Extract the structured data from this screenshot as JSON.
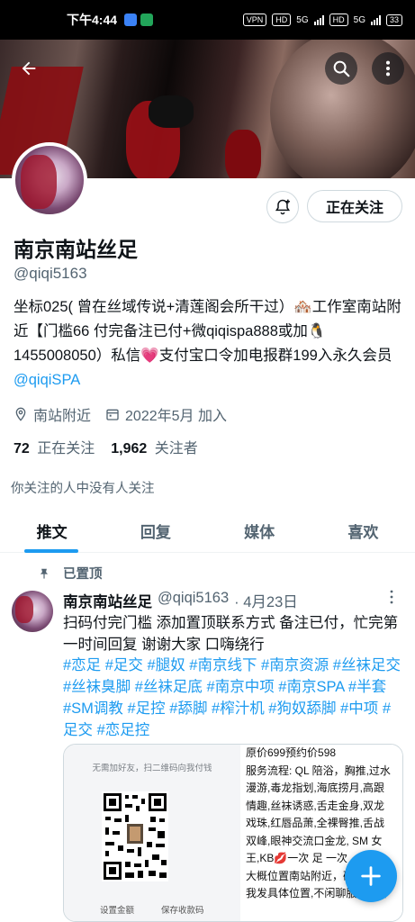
{
  "status_bar": {
    "time": "下午4:44",
    "vpn": "VPN",
    "hd": "HD",
    "net": "5G",
    "battery": "33"
  },
  "header": {
    "back_icon": "arrow-left-icon",
    "search_icon": "search-icon",
    "more_icon": "more-vertical-icon"
  },
  "profile": {
    "name": "南京南站丝足",
    "handle": "@qiqi5163",
    "follow_label": "正在关注",
    "notify_icon": "bell-plus-icon",
    "bio_text": "坐标025( 曾在丝域传说+清莲阁会所干过）🏘️工作室南站附近【门槛66 付完备注已付+微qiqispa888或加🐧1455008050）私信💗支付宝口令加电报群199入永久会员 ",
    "bio_link": "@qiqiSPA",
    "location": "南站附近",
    "joined": "2022年5月 加入",
    "following_count": "72",
    "following_label": "正在关注",
    "followers_count": "1,962",
    "followers_label": "关注者",
    "mutuals": "你关注的人中没有人关注"
  },
  "tabs": [
    {
      "label": "推文",
      "active": true
    },
    {
      "label": "回复",
      "active": false
    },
    {
      "label": "媒体",
      "active": false
    },
    {
      "label": "喜欢",
      "active": false
    }
  ],
  "tweet": {
    "pinned_label": "已置顶",
    "author": "南京南站丝足",
    "handle": "@qiqi5163",
    "date": "· 4月23日",
    "text": "扫码付完门槛 添加置顶联系方式 备注已付，忙完第一时间回复 谢谢大家 口嗨绕行",
    "hashtags": "#恋足 #足交 #腿奴 #南京线下 #南京资源 #丝袜足交 #丝袜臭脚 #丝袜足底 #南京中项 #南京SPA #半套 #SM调教 #足控 #舔脚 #榨汁机 #狗奴舔脚 #中项 #足交 #恋足控",
    "media_left_caption": "无需加好友，扫二维码向我付钱",
    "media_btn_1": "设置金额",
    "media_btn_2": "保存收款码",
    "media_right_lines": [
      "原价699预约价598",
      "服务流程: QL 陪浴，胸推,过水",
      "漫游,毒龙指划,海底捞月,高跟",
      "情趣,丝袜诱惑,舌走金身,双龙",
      "戏珠,红唇品萧,全裸臀推,舌战",
      "双峰,眼神交流口金龙, SM 女",
      "王,KB💋一次 足 一次",
      "大概位置南站附近，确",
      "我发具体位置,不闲聊服务以外"
    ]
  },
  "fab_icon": "plus-icon",
  "colors": {
    "accent": "#1d9bf0",
    "text": "#0f1419",
    "muted": "#536471"
  }
}
